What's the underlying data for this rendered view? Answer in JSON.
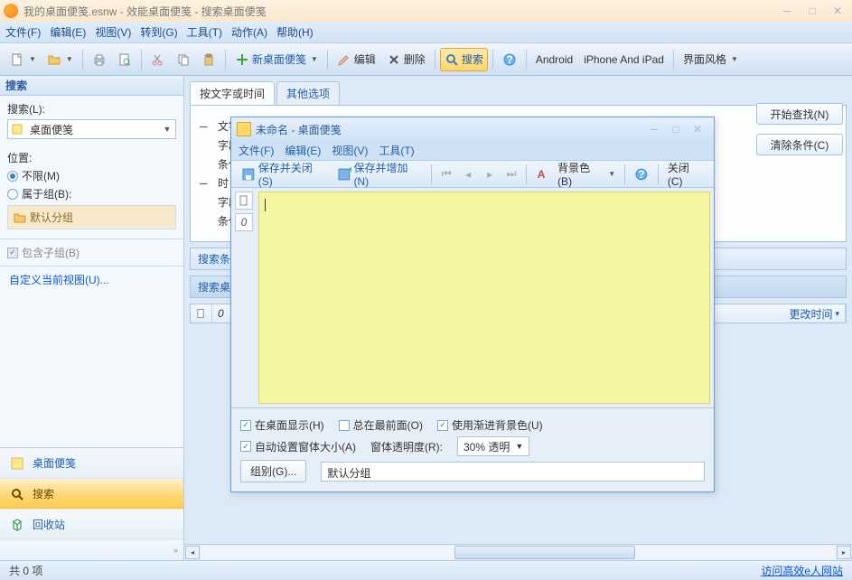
{
  "titlebar": {
    "title": "我的桌面便笺.esnw - 效能桌面便笺 - 搜索桌面便笺"
  },
  "menubar": {
    "file": "文件(F)",
    "edit": "编辑(E)",
    "view": "视图(V)",
    "goto": "转到(G)",
    "tools": "工具(T)",
    "action": "动作(A)",
    "help": "帮助(H)"
  },
  "toolbar": {
    "new_note": "新桌面便笺",
    "edit": "编辑",
    "delete": "删除",
    "search": "搜索",
    "android": "Android",
    "iphone": "iPhone And iPad",
    "style": "界面风格"
  },
  "sidebar": {
    "search_header": "搜索",
    "search_label": "搜索(L):",
    "search_combo": "桌面便笺",
    "location_label": "位置:",
    "radio_unlimited": "不限(M)",
    "radio_group": "属于组(B):",
    "default_group": "默认分组",
    "include_sub": "包含子组(B)",
    "custom_view": "自定义当前视图(U)...",
    "nav_notes": "桌面便笺",
    "nav_search": "搜索",
    "nav_recycle": "回收站"
  },
  "content": {
    "tab_text_time": "按文字或时间",
    "tab_other": "其他选项",
    "row_text": "文字",
    "row_field": "字段",
    "row_cond": "条件",
    "row_time": "时",
    "search_bar": "搜索条",
    "search_notes": "搜索桌",
    "col_change_time": "更改时间"
  },
  "buttons": {
    "start_search": "开始查找(N)",
    "clear_cond": "清除条件(C)"
  },
  "modal": {
    "title": "未命名 - 桌面便笺",
    "menu_file": "文件(F)",
    "menu_edit": "编辑(E)",
    "menu_view": "视图(V)",
    "menu_tools": "工具(T)",
    "save_close": "保存并关闭(S)",
    "save_add": "保存并增加(N)",
    "bgcolor": "背景色(B)",
    "close": "关闭(C)",
    "show_desktop": "在桌面显示(H)",
    "always_top": "总在最前面(O)",
    "gradient_bg": "使用渐进背景色(U)",
    "auto_size": "自动设置窗体大小(A)",
    "opacity_label": "窗体透明度(R):",
    "opacity_value": "30% 透明",
    "group_btn": "组别(G)...",
    "group_value": "默认分组",
    "font_letter": "A"
  },
  "statusbar": {
    "count": "共 0 项",
    "link": "访问高效e人网站"
  }
}
